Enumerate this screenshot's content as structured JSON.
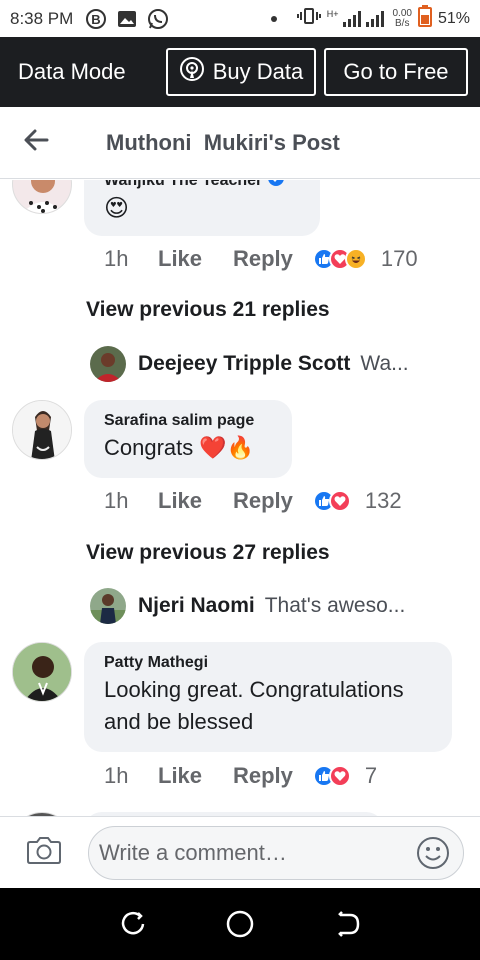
{
  "status_bar": {
    "time": "8:38 PM",
    "net_speed_value": "0.00",
    "net_speed_unit": "B/s",
    "battery": "51%",
    "network_type": "H+",
    "icons": [
      "b-circle-icon",
      "image-icon",
      "whatsapp-icon",
      "dot-icon",
      "vibrate-icon",
      "signal-icon",
      "battery-icon"
    ]
  },
  "data_mode": {
    "label": "Data Mode",
    "buy_label": "Buy Data",
    "free_label": "Go to Free"
  },
  "header": {
    "title": "Muthoni  Mukiri's Post"
  },
  "comments": [
    {
      "name": "Wanjiku The Teacher",
      "verified": true,
      "emoji": "😍",
      "time": "1h",
      "like": "Like",
      "reply": "Reply",
      "reactions": [
        "like",
        "love",
        "haha"
      ],
      "reaction_count": "170"
    },
    {
      "view_previous": "View previous 21 replies",
      "reply_preview_name": "Deejeey Tripple Scott",
      "reply_preview_text": "Wa..."
    },
    {
      "name": "Sarafina salim page",
      "text": "Congrats",
      "emoji": "❤️🔥",
      "time": "1h",
      "like": "Like",
      "reply": "Reply",
      "reactions": [
        "like",
        "love"
      ],
      "reaction_count": "132"
    },
    {
      "view_previous": "View previous 27 replies",
      "reply_preview_name": "Njeri Naomi",
      "reply_preview_text": "That's aweso..."
    },
    {
      "name": "Patty Mathegi",
      "text_line1": "Looking great. Congratulations",
      "text_line2": "and be blessed",
      "time": "1h",
      "like": "Like",
      "reply": "Reply",
      "reactions": [
        "like",
        "love"
      ],
      "reaction_count": "7"
    }
  ],
  "composer": {
    "placeholder": "Write a comment…"
  },
  "colors": {
    "data_bar_bg": "#1c1e21",
    "bubble_bg": "#f0f2f5",
    "like_blue": "#1877f2",
    "love_red": "#f33e58",
    "haha_yellow": "#f7b125"
  }
}
